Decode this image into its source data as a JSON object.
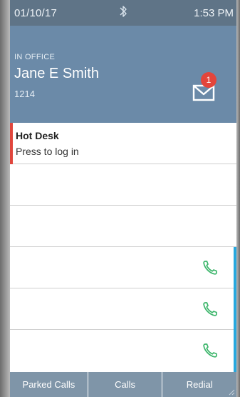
{
  "status_bar": {
    "date": "01/10/17",
    "time": "1:53 PM",
    "bluetooth_icon": "bluetooth-icon"
  },
  "header": {
    "presence": "IN OFFICE",
    "name": "Jane E Smith",
    "extension": "1214",
    "voicemail_count": "1",
    "voicemail_icon": "envelope-icon"
  },
  "lines": [
    {
      "title": "Hot Desk",
      "subtitle": "Press to log in"
    },
    {
      "title": "",
      "subtitle": ""
    },
    {
      "title": "",
      "subtitle": ""
    },
    {
      "title": "",
      "subtitle": "",
      "icon": "phone-icon"
    },
    {
      "title": "",
      "subtitle": "",
      "icon": "phone-icon"
    },
    {
      "title": "",
      "subtitle": "",
      "icon": "phone-icon"
    }
  ],
  "softkeys": {
    "parked_calls": "Parked Calls",
    "calls": "Calls",
    "redial": "Redial"
  },
  "colors": {
    "status_bar": "#5f7487",
    "header": "#6b8aa8",
    "softkeys": "#7f95a8",
    "hot_desk_accent": "#e0463d",
    "line_accent": "#27a8de",
    "phone_icon": "#3bb56a",
    "badge": "#e3453b"
  }
}
